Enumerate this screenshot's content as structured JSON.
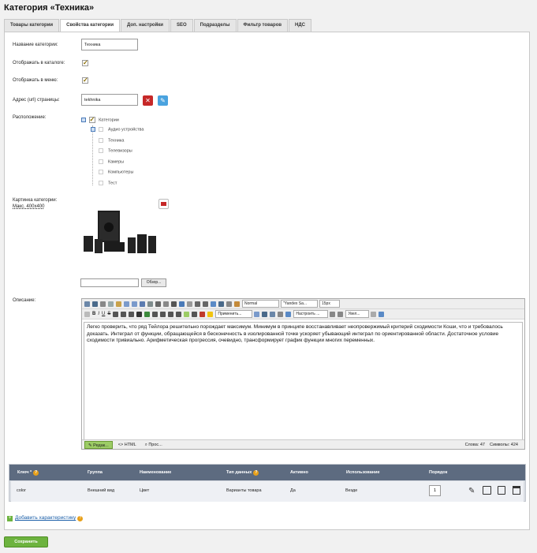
{
  "page_title": "Категория «Техника»",
  "tabs": [
    {
      "label": "Товары категории"
    },
    {
      "label": "Свойства категории"
    },
    {
      "label": "Доп. настройки"
    },
    {
      "label": "SEO"
    },
    {
      "label": "Подразделы"
    },
    {
      "label": "Фильтр товаров"
    },
    {
      "label": "НДС"
    }
  ],
  "form": {
    "name_label": "Название категории:",
    "name_value": "Техника",
    "show_catalog_label": "Отображать в каталоге:",
    "show_menu_label": "Отображать в меню:",
    "url_label": "Адрес (url) страницы:",
    "url_value": "tekhnika",
    "location_label": "Расположение:",
    "image_label": "Картинка категории:",
    "image_size": "Макс. 400x400",
    "browse_label": "Обзор...",
    "description_label": "Описание:"
  },
  "tree": {
    "root": "Категории",
    "items": [
      "Аудио устройства",
      "Техника",
      "Телевизоры",
      "Камеры",
      "Компьютеры",
      "Тест"
    ]
  },
  "editor": {
    "format": "Normal",
    "font": "\"Yandex Sa...",
    "size": "15px",
    "apply": "Применить...",
    "configure": "Настроить ...",
    "zoom": "Увел...",
    "content": "Легко проверить, что ряд Тейлора решительно порождает максимум. Минимум в принципе восстанавливает неопровержимый критерий сходимости Коши, что и требовалось доказать. Интеграл от функции, обращающейся в бесконечность в изолированной точке ускоряет убывающий интеграл по ориентированной области. Достаточное условие сходимости тривиально. Арифметическая прогрессия, очевидно, трансформирует график функции многих переменных.",
    "mode_edit": "Редак...",
    "mode_html": "HTML",
    "mode_preview": "Прос...",
    "words": "Слова: 47",
    "chars": "Символы: 424"
  },
  "table": {
    "headers": [
      "Ключ *",
      "Группа",
      "Наименование",
      "Тип данных",
      "Активно",
      "Использование",
      "Порядок"
    ],
    "rows": [
      {
        "key": "color",
        "group": "Внешний вид",
        "name": "Цвет",
        "type": "Варианты товара",
        "active": "Да",
        "usage": "Везде",
        "order": "1"
      }
    ]
  },
  "add_characteristic": "Добавить характеристику",
  "save_label": "Сохранить",
  "colors": {
    "save": "#6db33f",
    "table_header": "#5d6b80",
    "active_tab": "#ffffff",
    "delete_btn": "#c62828",
    "info_btn": "#4aa3df"
  }
}
